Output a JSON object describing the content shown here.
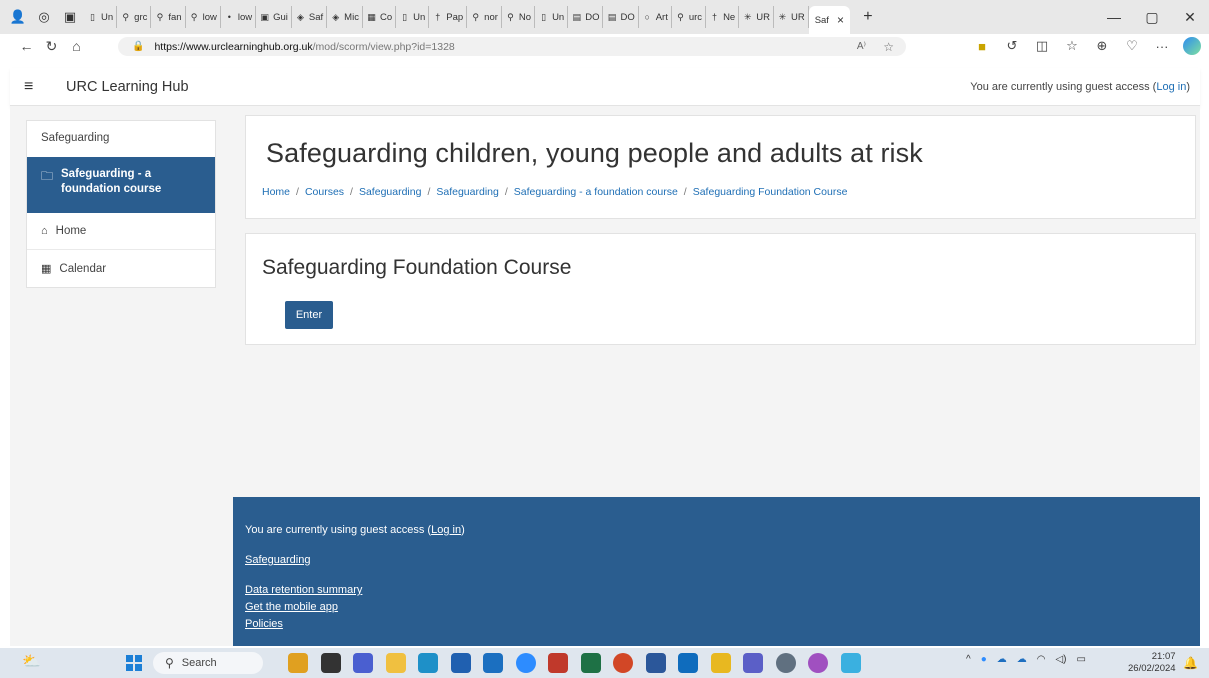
{
  "browser": {
    "tabs": [
      {
        "label": "Un",
        "icon": "page-icon"
      },
      {
        "label": "grc",
        "icon": "search-icon"
      },
      {
        "label": "fan",
        "icon": "search-icon"
      },
      {
        "label": "low",
        "icon": "search-icon"
      },
      {
        "label": "low",
        "icon": "dot-icon"
      },
      {
        "label": "Gui",
        "icon": "image-icon"
      },
      {
        "label": "Saf",
        "icon": "moodle-icon"
      },
      {
        "label": "Mic",
        "icon": "moodle-icon"
      },
      {
        "label": "Co",
        "icon": "grid-icon"
      },
      {
        "label": "Un",
        "icon": "page-icon"
      },
      {
        "label": "Pap",
        "icon": "cross-icon"
      },
      {
        "label": "nor",
        "icon": "search-icon"
      },
      {
        "label": "No",
        "icon": "search-icon"
      },
      {
        "label": "Un",
        "icon": "page-icon"
      },
      {
        "label": "DO",
        "icon": "pdf-icon"
      },
      {
        "label": "DO",
        "icon": "pdf-icon"
      },
      {
        "label": "Art",
        "icon": "circle-icon"
      },
      {
        "label": "urc",
        "icon": "search-icon"
      },
      {
        "label": "Ne",
        "icon": "cross-icon"
      },
      {
        "label": "UR",
        "icon": "star-icon"
      },
      {
        "label": "UR",
        "icon": "star-icon"
      }
    ],
    "active_tab": {
      "label": "Saf",
      "close": "×"
    },
    "new_tab": "+",
    "window_controls": {
      "minimize": "—",
      "maximize": "▢",
      "close": "✕"
    },
    "url_host": "https://www.urclearninghub.org.uk",
    "url_path": "/mod/scorm/view.php?id=1328",
    "read_aloud": "A⁾"
  },
  "site": {
    "name": "URC Learning Hub",
    "guest_prefix": "You are currently using guest access (",
    "login_link": "Log in",
    "guest_suffix": ")"
  },
  "sidebar": {
    "heading": "Safeguarding",
    "active_item": "Safeguarding - a foundation course",
    "items": [
      {
        "label": "Home",
        "icon": "home-icon"
      },
      {
        "label": "Calendar",
        "icon": "calendar-icon"
      }
    ]
  },
  "header": {
    "title": "Safeguarding children, young people and adults at risk",
    "breadcrumb": [
      "Home",
      "Courses",
      "Safeguarding",
      "Safeguarding",
      "Safeguarding - a foundation course",
      "Safeguarding Foundation Course"
    ],
    "separator": "/"
  },
  "course": {
    "title": "Safeguarding Foundation Course",
    "enter_label": "Enter"
  },
  "footer": {
    "guest_prefix": "You are currently using guest access (",
    "login_link": "Log in",
    "guest_suffix": ")",
    "links": [
      "Safeguarding",
      "Data retention summary",
      "Get the mobile app",
      "Policies"
    ]
  },
  "taskbar": {
    "search_placeholder": "Search",
    "time": "21:07",
    "date": "26/02/2024"
  },
  "colors": {
    "primary": "#2a5d8f",
    "link": "#1f6fb5",
    "page_bg": "#f4f4f4"
  }
}
